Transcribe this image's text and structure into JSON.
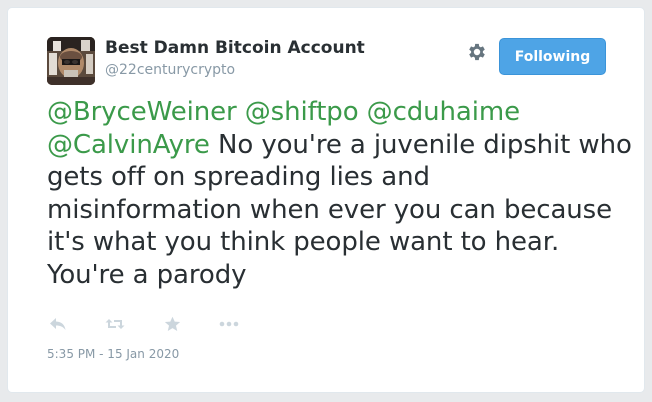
{
  "user": {
    "display_name": "Best Damn Bitcoin Account",
    "handle": "@22centurycrypto"
  },
  "header": {
    "follow_label": "Following",
    "settings_icon": "gear-icon"
  },
  "tweet": {
    "mentions": [
      "@BryceWeiner",
      "@shiftpo",
      "@cduhaime",
      "@CalvinAyre"
    ],
    "body": "No you're a juvenile dipshit who gets off on spreading lies and misinformation when ever you can because it's what you think people want to hear. You're a parody",
    "timestamp": "5:35 PM - 15 Jan 2020"
  },
  "actions": {
    "reply_icon": "reply-icon",
    "retweet_icon": "retweet-icon",
    "like_icon": "star-icon",
    "more_icon": "more-icon"
  },
  "colors": {
    "mention": "#3b9a4a",
    "button": "#4ea4e6",
    "text": "#292f33",
    "muted": "#8899a6",
    "icon": "#ccd6dd"
  }
}
